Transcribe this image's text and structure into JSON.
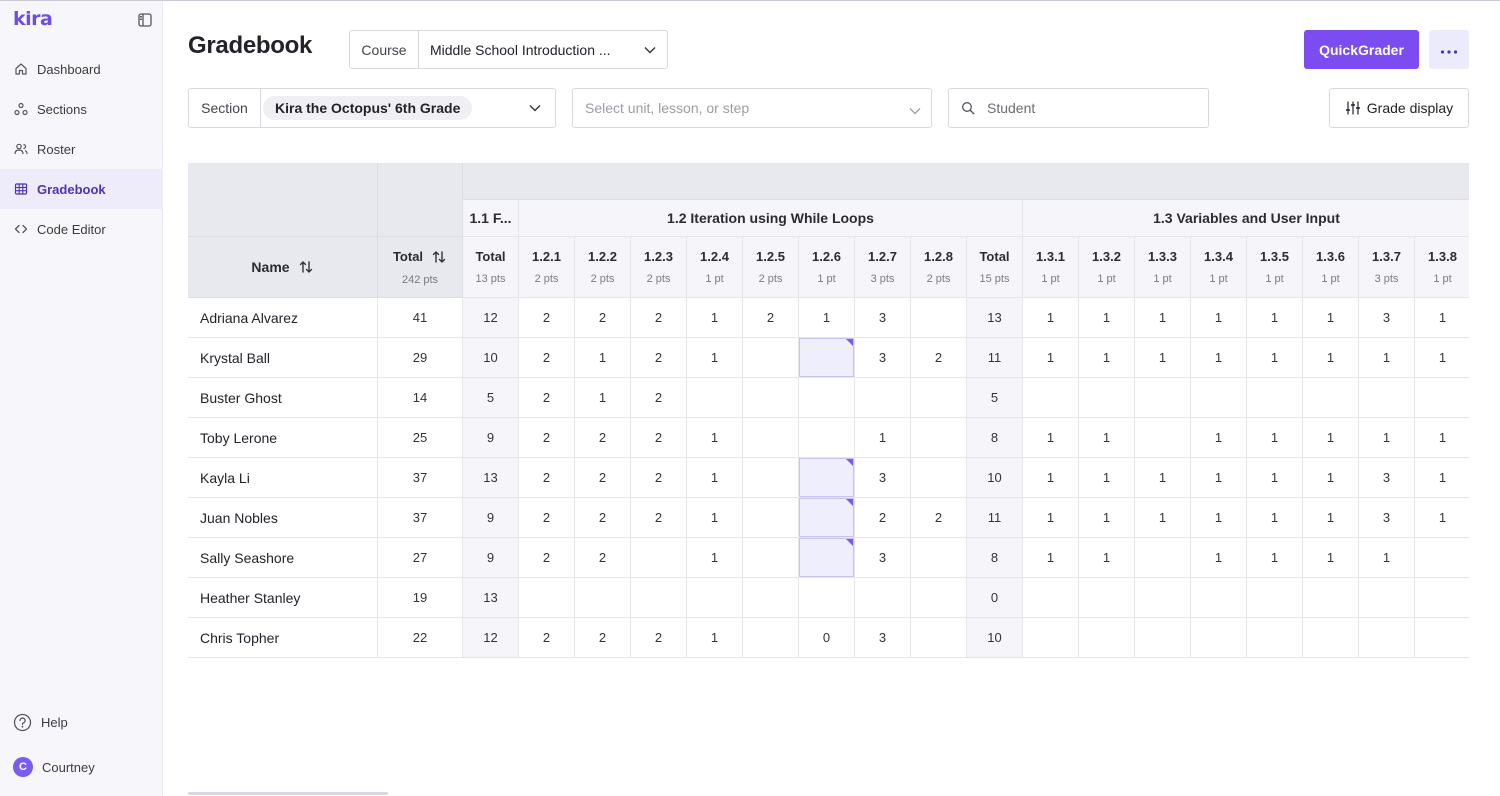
{
  "app": {
    "logo": "kira"
  },
  "sidebar": {
    "items": [
      {
        "label": "Dashboard",
        "icon": "home-icon",
        "active": false
      },
      {
        "label": "Sections",
        "icon": "sections-icon",
        "active": false
      },
      {
        "label": "Roster",
        "icon": "roster-icon",
        "active": false
      },
      {
        "label": "Gradebook",
        "icon": "grid-icon",
        "active": true
      },
      {
        "label": "Code Editor",
        "icon": "code-icon",
        "active": false
      }
    ],
    "help_label": "Help",
    "user": {
      "initial": "C",
      "name": "Courtney"
    }
  },
  "header": {
    "title": "Gradebook",
    "course_label": "Course",
    "course_value": "Middle School Introduction ...",
    "quickgrader_label": "QuickGrader"
  },
  "filters": {
    "section_label": "Section",
    "section_value": "Kira the Octopus' 6th Grade",
    "unit_placeholder": "Select unit, lesson, or step",
    "student_placeholder": "Student",
    "grade_display_label": "Grade display"
  },
  "colors": {
    "accent": "#7b4cf0",
    "active_nav": "#4b34b6",
    "flag": "#7b5cf0"
  },
  "gradebook": {
    "name_header": "Name",
    "total_header": {
      "title": "Total",
      "points": "242 pts"
    },
    "lessons": [
      {
        "title": "1.1 F...",
        "columns": [
          {
            "title": "Total",
            "points": "13 pts",
            "is_total": true
          }
        ]
      },
      {
        "title": "1.2 Iteration using While Loops",
        "columns": [
          {
            "title": "1.2.1",
            "points": "2 pts"
          },
          {
            "title": "1.2.2",
            "points": "2 pts"
          },
          {
            "title": "1.2.3",
            "points": "2 pts"
          },
          {
            "title": "1.2.4",
            "points": "1 pt"
          },
          {
            "title": "1.2.5",
            "points": "2 pts"
          },
          {
            "title": "1.2.6",
            "points": "1 pt"
          },
          {
            "title": "1.2.7",
            "points": "3 pts"
          },
          {
            "title": "1.2.8",
            "points": "2 pts"
          },
          {
            "title": "Total",
            "points": "15 pts",
            "is_total": true
          }
        ]
      },
      {
        "title": "1.3 Variables and User Input",
        "columns": [
          {
            "title": "1.3.1",
            "points": "1 pt"
          },
          {
            "title": "1.3.2",
            "points": "1 pt"
          },
          {
            "title": "1.3.3",
            "points": "1 pt"
          },
          {
            "title": "1.3.4",
            "points": "1 pt"
          },
          {
            "title": "1.3.5",
            "points": "1 pt"
          },
          {
            "title": "1.3.6",
            "points": "1 pt"
          },
          {
            "title": "1.3.7",
            "points": "3 pts"
          },
          {
            "title": "1.3.8",
            "points": "1 pt"
          }
        ]
      }
    ],
    "flagged_column": 6,
    "rows": [
      {
        "name": "Adriana Alvarez",
        "total": "41",
        "cells": [
          "12",
          "2",
          "2",
          "2",
          "1",
          "2",
          "1",
          "3",
          "",
          "13",
          "1",
          "1",
          "1",
          "1",
          "1",
          "1",
          "3",
          "1"
        ],
        "flagged": false
      },
      {
        "name": "Krystal Ball",
        "total": "29",
        "cells": [
          "10",
          "2",
          "1",
          "2",
          "1",
          "",
          "",
          "3",
          "2",
          "11",
          "1",
          "1",
          "1",
          "1",
          "1",
          "1",
          "1",
          "1"
        ],
        "flagged": true
      },
      {
        "name": "Buster Ghost",
        "total": "14",
        "cells": [
          "5",
          "2",
          "1",
          "2",
          "",
          "",
          "",
          "",
          "",
          "5",
          "",
          "",
          "",
          "",
          "",
          "",
          "",
          ""
        ],
        "flagged": false
      },
      {
        "name": "Toby Lerone",
        "total": "25",
        "cells": [
          "9",
          "2",
          "2",
          "2",
          "1",
          "",
          "",
          "1",
          "",
          "8",
          "1",
          "1",
          "",
          "1",
          "1",
          "1",
          "1",
          "1"
        ],
        "flagged": false
      },
      {
        "name": "Kayla Li",
        "total": "37",
        "cells": [
          "13",
          "2",
          "2",
          "2",
          "1",
          "",
          "",
          "3",
          "",
          "10",
          "1",
          "1",
          "1",
          "1",
          "1",
          "1",
          "3",
          "1"
        ],
        "flagged": true
      },
      {
        "name": "Juan Nobles",
        "total": "37",
        "cells": [
          "9",
          "2",
          "2",
          "2",
          "1",
          "",
          "",
          "2",
          "2",
          "11",
          "1",
          "1",
          "1",
          "1",
          "1",
          "1",
          "3",
          "1"
        ],
        "flagged": true
      },
      {
        "name": "Sally Seashore",
        "total": "27",
        "cells": [
          "9",
          "2",
          "2",
          "",
          "1",
          "",
          "",
          "3",
          "",
          "8",
          "1",
          "1",
          "",
          "1",
          "1",
          "1",
          "1",
          ""
        ],
        "flagged": true
      },
      {
        "name": "Heather Stanley",
        "total": "19",
        "cells": [
          "13",
          "",
          "",
          "",
          "",
          "",
          "",
          "",
          "",
          "0",
          "",
          "",
          "",
          "",
          "",
          "",
          "",
          ""
        ],
        "flagged": false
      },
      {
        "name": "Chris Topher",
        "total": "22",
        "cells": [
          "12",
          "2",
          "2",
          "2",
          "1",
          "",
          "0",
          "3",
          "",
          "10",
          "",
          "",
          "",
          "",
          "",
          "",
          "",
          ""
        ],
        "flagged": false
      }
    ]
  }
}
